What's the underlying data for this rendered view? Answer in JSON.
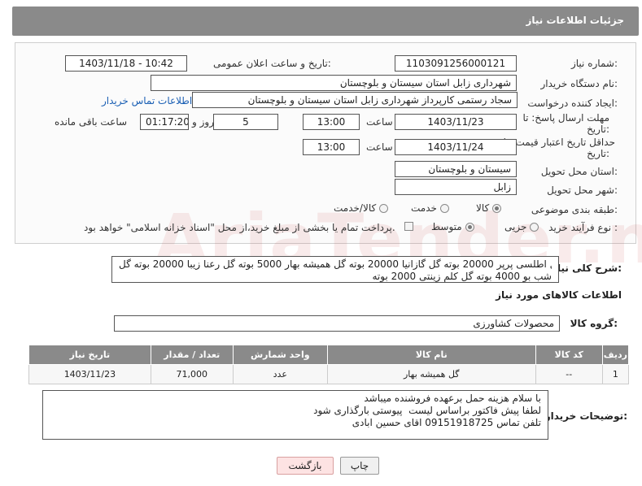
{
  "header": {
    "title": "جزئیات اطلاعات نیاز"
  },
  "form": {
    "need_number_label": "شماره نیاز:",
    "need_number": "1103091256000121",
    "announce_label": "تاریخ و ساعت اعلان عمومی:",
    "announce_value": "1403/11/18 - 10:42",
    "buyer_org_label": "نام دستگاه خریدار:",
    "buyer_org": "شهرداری زابل استان سیستان و بلوچستان",
    "creator_label": "ایجاد کننده درخواست:",
    "creator": "سجاد رستمی کارپرداز شهرداری زابل استان سیستان و بلوچستان",
    "buyer_contact_link": "اطلاعات تماس خریدار",
    "deadline_label": "مهلت ارسال پاسخ: تا تاریخ:",
    "deadline_date": "1403/11/23",
    "time_label": "ساعت",
    "deadline_time": "13:00",
    "days_value": "5",
    "days_label": "روز و",
    "remaining_time": "01:17:20",
    "remaining_label": "ساعت باقی مانده",
    "validity_label": "حداقل تاریخ اعتبار قیمت: تا تاریخ:",
    "validity_date": "1403/11/24",
    "validity_time": "13:00",
    "province_label": "استان محل تحویل:",
    "province": "سیستان و بلوچستان",
    "city_label": "شهر محل تحویل:",
    "city": "زابل",
    "category_label": "طبقه بندی موضوعی:",
    "category_options": [
      "کالا",
      "خدمت",
      "کالا/خدمت"
    ],
    "process_label": "نوع فرآیند خرید :",
    "process_options": [
      "جزیی",
      "متوسط"
    ],
    "payment_note": "پرداخت تمام یا بخشی از مبلغ خرید،از محل \"اسناد خزانه اسلامی\" خواهد بود."
  },
  "description": {
    "label": "شرح کلی نیاز:",
    "line1": "گل اطلسی پرپر 20000 بوته گل گازانیا 20000 بوته گل همیشه بهار 5000 بوته گل رعنا زیبا 20000 بوته گل",
    "line2": "شب بو 4000 بوته گل کلم زینتی 2000 بوته"
  },
  "goods": {
    "section_title": "اطلاعات کالاهای مورد نیاز",
    "group_label": "گروه کالا:",
    "group_value": "محصولات کشاورزی",
    "columns": [
      "ردیف",
      "کد کالا",
      "نام کالا",
      "واحد شمارش",
      "تعداد / مقدار",
      "تاریخ نیاز"
    ],
    "rows": [
      {
        "row": "1",
        "code": "--",
        "name": "گل همیشه بهار",
        "unit": "عدد",
        "qty": "71,000",
        "date": "1403/11/23"
      }
    ]
  },
  "buyer_notes": {
    "label": "توضیحات خریدار:",
    "line1": "با سلام هزینه حمل برعهده فروشنده میباشد",
    "line2": "لطفا پیش فاکتور براساس لیست  پیوستی بارگذاری شود",
    "line3": "تلفن تماس 09151918725 اقای حسین ابادی"
  },
  "buttons": {
    "print": "چاپ",
    "back": "بازگشت"
  },
  "watermark": "AriaTender.neT",
  "colors": {
    "header_bg": "#8a8a8a",
    "link": "#1a5fb4",
    "back_button": "#fde3e3"
  }
}
